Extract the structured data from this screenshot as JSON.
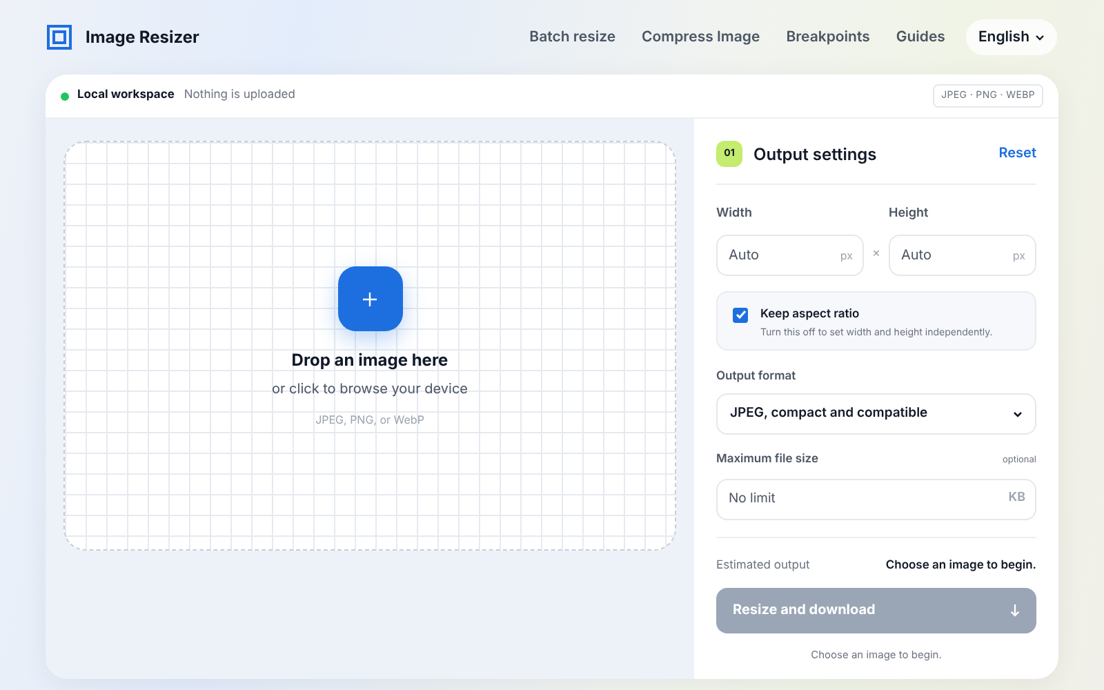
{
  "header": {
    "app_name": "Image Resizer",
    "nav": [
      {
        "label": "Batch resize"
      },
      {
        "label": "Compress Image"
      },
      {
        "label": "Breakpoints"
      },
      {
        "label": "Guides"
      }
    ],
    "language": "English"
  },
  "status_bar": {
    "online": true,
    "title": "Local workspace",
    "note": "Nothing is uploaded",
    "formats": "JPEG · PNG · WEBP"
  },
  "dropzone": {
    "title": "Drop an image here",
    "subtitle": "or click to browse your device",
    "formats": "JPEG, PNG, or WebP"
  },
  "settings": {
    "step": "01",
    "title": "Output settings",
    "reset": "Reset",
    "width": {
      "label": "Width",
      "placeholder": "Auto",
      "unit": "px"
    },
    "separator": "×",
    "height": {
      "label": "Height",
      "placeholder": "Auto",
      "unit": "px"
    },
    "aspect": {
      "label": "Keep aspect ratio",
      "hint": "Turn this off to set width and height independently.",
      "checked": true
    },
    "format": {
      "label": "Output format",
      "value": "JPEG, compact and compatible"
    },
    "max_size": {
      "label": "Maximum file size",
      "tag": "optional",
      "placeholder": "No limit",
      "unit": "KB"
    },
    "estimate": {
      "label": "Estimated output",
      "value": "Choose an image to begin."
    },
    "submit": {
      "label": "Resize and download",
      "disabled": true
    },
    "footnote": "Choose an image to begin."
  }
}
